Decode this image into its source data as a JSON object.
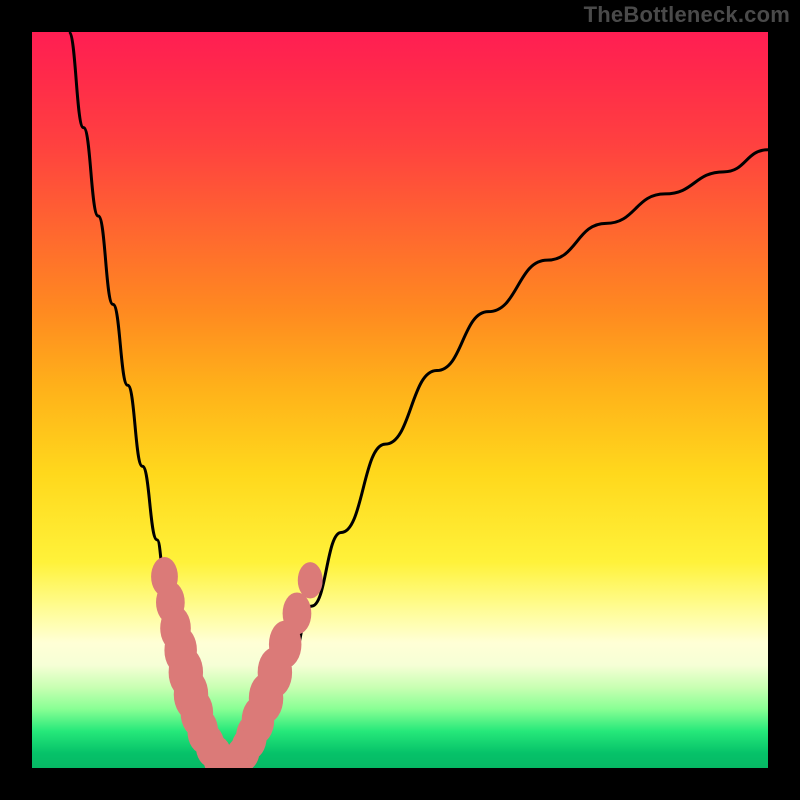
{
  "watermark": {
    "text": "TheBottleneck.com"
  },
  "chart_data": {
    "type": "line",
    "title": "",
    "xlabel": "",
    "ylabel": "",
    "xlim": [
      0,
      100
    ],
    "ylim": [
      0,
      100
    ],
    "grid": false,
    "background": "vertical rainbow gradient (red top → green bottom)",
    "series": [
      {
        "name": "left-curve",
        "x": [
          5,
          7,
          9,
          11,
          13,
          15,
          17,
          18,
          19,
          20,
          21,
          22,
          23,
          24,
          25,
          26
        ],
        "y": [
          100,
          87,
          75,
          63,
          52,
          41,
          31,
          26,
          21,
          16,
          12,
          8,
          5,
          3,
          1.5,
          0.5
        ],
        "stroke": "#000000"
      },
      {
        "name": "right-curve",
        "x": [
          28,
          29,
          30,
          31,
          33,
          35,
          38,
          42,
          48,
          55,
          62,
          70,
          78,
          86,
          94,
          100
        ],
        "y": [
          0.5,
          1.5,
          3,
          5,
          9,
          14,
          22,
          32,
          44,
          54,
          62,
          69,
          74,
          78,
          81,
          84
        ],
        "stroke": "#000000"
      },
      {
        "name": "left-beads",
        "points": [
          {
            "x": 18.0,
            "y": 26.0,
            "r": 1.4
          },
          {
            "x": 18.8,
            "y": 22.5,
            "r": 1.5
          },
          {
            "x": 19.5,
            "y": 19.0,
            "r": 1.6
          },
          {
            "x": 20.2,
            "y": 16.0,
            "r": 1.7
          },
          {
            "x": 20.9,
            "y": 13.0,
            "r": 1.8
          },
          {
            "x": 21.6,
            "y": 10.0,
            "r": 1.8
          },
          {
            "x": 22.4,
            "y": 7.5,
            "r": 1.7
          },
          {
            "x": 23.2,
            "y": 5.0,
            "r": 1.6
          },
          {
            "x": 24.2,
            "y": 3.0,
            "r": 1.5
          },
          {
            "x": 25.2,
            "y": 1.5,
            "r": 1.5
          }
        ],
        "fill": "#db7a78"
      },
      {
        "name": "right-beads",
        "points": [
          {
            "x": 28.2,
            "y": 1.2,
            "r": 1.5
          },
          {
            "x": 29.0,
            "y": 2.5,
            "r": 1.5
          },
          {
            "x": 29.8,
            "y": 4.2,
            "r": 1.6
          },
          {
            "x": 30.7,
            "y": 6.5,
            "r": 1.7
          },
          {
            "x": 31.8,
            "y": 9.5,
            "r": 1.8
          },
          {
            "x": 33.0,
            "y": 13.0,
            "r": 1.8
          },
          {
            "x": 34.4,
            "y": 16.8,
            "r": 1.7
          },
          {
            "x": 36.0,
            "y": 21.0,
            "r": 1.5
          },
          {
            "x": 37.8,
            "y": 25.5,
            "r": 1.3
          }
        ],
        "fill": "#db7a78"
      },
      {
        "name": "bottom-beads",
        "points": [
          {
            "x": 25.4,
            "y": 0.6,
            "r": 1.4
          },
          {
            "x": 26.4,
            "y": 0.4,
            "r": 1.4
          },
          {
            "x": 27.4,
            "y": 0.5,
            "r": 1.4
          }
        ],
        "fill": "#db7a78"
      }
    ]
  }
}
